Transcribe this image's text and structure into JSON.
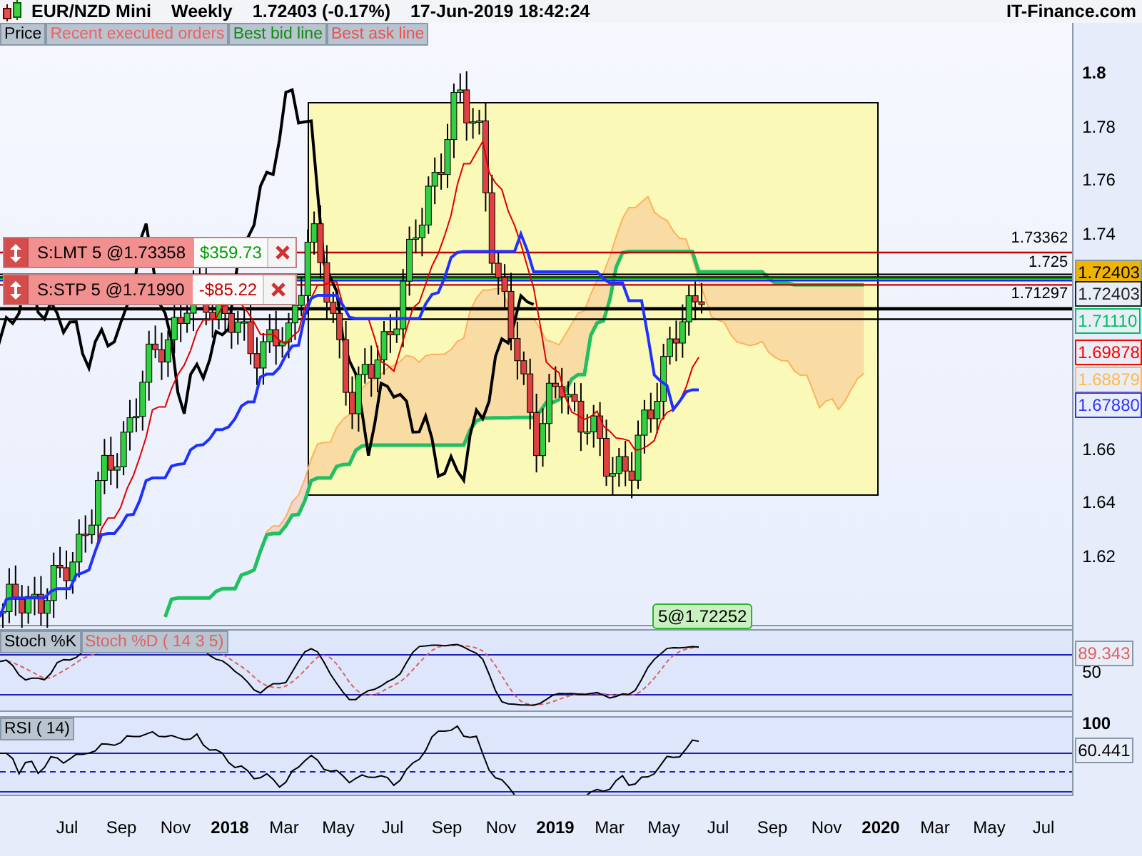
{
  "header": {
    "symbol": "EUR/NZD Mini",
    "period": "Weekly",
    "quote": "1.72403 (-0.17%)",
    "datetime": "17-Jun-2019 18:42:24",
    "brand": "IT-Finance.com"
  },
  "legend": [
    {
      "label": "Price",
      "color": "#000000"
    },
    {
      "label": "Recent executed orders",
      "color": "#f06060"
    },
    {
      "label": "Best bid line",
      "color": "#108a10"
    },
    {
      "label": "Best ask line",
      "color": "#f05050"
    }
  ],
  "price_axis": [
    {
      "label": "1.8",
      "bold": true
    },
    {
      "label": "1.78",
      "bold": false
    },
    {
      "label": "1.76",
      "bold": false
    },
    {
      "label": "1.74",
      "bold": false
    },
    {
      "label": "1.66",
      "bold": false
    },
    {
      "label": "1.64",
      "bold": false
    },
    {
      "label": "1.62",
      "bold": false
    }
  ],
  "level_labels": [
    "1.73362",
    "1.725",
    "1.71297"
  ],
  "price_tags": [
    {
      "value": "1.72403",
      "kind": "filled",
      "color": "#f0b400"
    },
    {
      "value": "1.72403",
      "kind": "outlined",
      "color": "#222222"
    },
    {
      "value": "1.71110",
      "kind": "outlined",
      "color": "#00c060"
    },
    {
      "value": "1.69878",
      "kind": "outlined",
      "color": "#ff0000"
    },
    {
      "value": "1.68879",
      "kind": "outlined",
      "color": "#ffb84d"
    },
    {
      "value": "1.67880",
      "kind": "outlined",
      "color": "#3333ff"
    }
  ],
  "orders": [
    {
      "label": "S:LMT  5 @1.73358",
      "pnl": "$359.73",
      "profit": true
    },
    {
      "label": "S:STP  5 @1.71990",
      "pnl": "-$85.22",
      "profit": false
    }
  ],
  "position_bubble": "5@1.72252",
  "stoch": {
    "tags": [
      "Stoch %K",
      "Stoch %D ( 14 3 5)"
    ],
    "axis_label": "50",
    "reading": "89.343"
  },
  "rsi": {
    "tag": "RSI ( 14)",
    "axis_label": "100",
    "reading": "60.441"
  },
  "time_axis": [
    {
      "label": "Jul",
      "bold": false
    },
    {
      "label": "Sep",
      "bold": false
    },
    {
      "label": "Nov",
      "bold": false
    },
    {
      "label": "2018",
      "bold": true
    },
    {
      "label": "Mar",
      "bold": false
    },
    {
      "label": "May",
      "bold": false
    },
    {
      "label": "Jul",
      "bold": false
    },
    {
      "label": "Sep",
      "bold": false
    },
    {
      "label": "Nov",
      "bold": false
    },
    {
      "label": "2019",
      "bold": true
    },
    {
      "label": "Mar",
      "bold": false
    },
    {
      "label": "May",
      "bold": false
    },
    {
      "label": "Jul",
      "bold": false
    },
    {
      "label": "Sep",
      "bold": false
    },
    {
      "label": "Nov",
      "bold": false
    },
    {
      "label": "2020",
      "bold": true
    },
    {
      "label": "Mar",
      "bold": false
    },
    {
      "label": "May",
      "bold": false
    },
    {
      "label": "Jul",
      "bold": false
    }
  ]
}
